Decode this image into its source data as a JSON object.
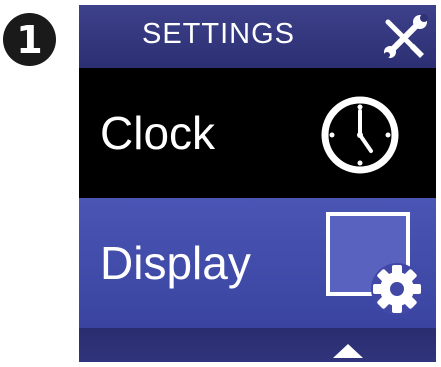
{
  "step": {
    "number": "1"
  },
  "header": {
    "title": "SETTINGS",
    "icon": "wrench-screwdriver-icon"
  },
  "menu": {
    "items": [
      {
        "label": "Clock",
        "icon": "clock-icon",
        "selected": false
      },
      {
        "label": "Display",
        "icon": "display-settings-icon",
        "selected": true
      }
    ]
  },
  "footer": {
    "icon": "up-arrow-icon"
  },
  "colors": {
    "header_bg": "#2c2f72",
    "selected_bg": "#4a55b4",
    "unselected_bg": "#000000",
    "text": "#ffffff"
  }
}
